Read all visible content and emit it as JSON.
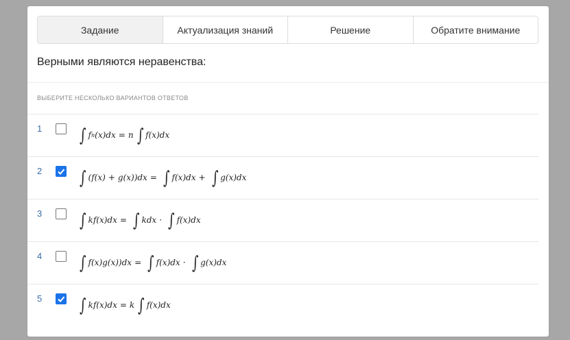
{
  "tabs": [
    {
      "label": "Задание",
      "active": true
    },
    {
      "label": "Актуализация знаний",
      "active": false
    },
    {
      "label": "Решение",
      "active": false
    },
    {
      "label": "Обратите внимание",
      "active": false
    }
  ],
  "question": "Верными являются неравенства:",
  "hint": "ВЫБЕРИТЕ НЕСКОЛЬКО ВАРИАНТОВ ОТВЕТОВ",
  "options": [
    {
      "number": "1",
      "checked": false,
      "formula": "∫fⁿ(x)dx = n∫f(x)dx"
    },
    {
      "number": "2",
      "checked": true,
      "formula": "∫(f(x)+g(x))dx = ∫f(x)dx + ∫g(x)dx"
    },
    {
      "number": "3",
      "checked": false,
      "formula": "∫kf(x)dx = ∫kdx · ∫f(x)dx"
    },
    {
      "number": "4",
      "checked": false,
      "formula": "∫f(x)g(x))dx = ∫f(x)dx · ∫g(x)dx"
    },
    {
      "number": "5",
      "checked": true,
      "formula": "∫kf(x)dx = k∫f(x)dx"
    }
  ],
  "colors": {
    "checkbox_checked": "#1a73e8",
    "number": "#3b6ea5"
  }
}
